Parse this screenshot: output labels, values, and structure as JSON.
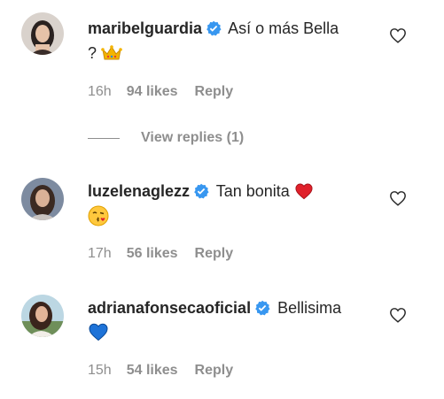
{
  "comments": [
    {
      "username": "maribelguardia",
      "text_line1": "Así o más Bella",
      "text_line2": "?",
      "emoji": "crown-icon",
      "time": "16h",
      "likes": "94 likes",
      "reply": "Reply"
    },
    {
      "username": "luzelenaglezz",
      "text_line1": "Tan bonita",
      "emoji_inline": "red-heart-icon",
      "emoji": "kissing-face-icon",
      "time": "17h",
      "likes": "56 likes",
      "reply": "Reply"
    },
    {
      "username": "adrianafonsecaoficial",
      "text_line1": "Bellisima",
      "emoji": "blue-heart-icon",
      "time": "15h",
      "likes": "54 likes",
      "reply": "Reply"
    }
  ],
  "view_replies": "View replies (1)",
  "colors": {
    "text": "#262626",
    "secondary": "#8e8e8e",
    "verified": "#3897f0"
  }
}
